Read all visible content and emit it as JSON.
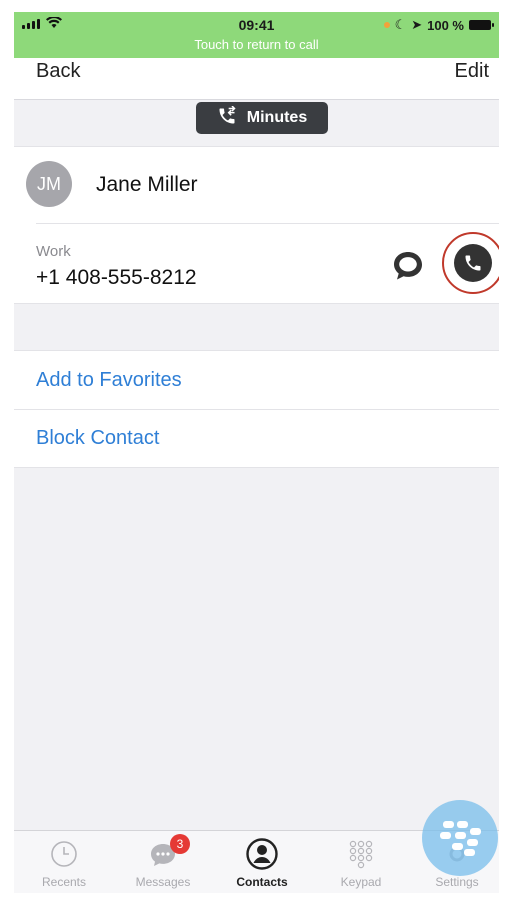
{
  "status_bar": {
    "time": "09:41",
    "banner": "Touch to return to call",
    "battery": "100 %",
    "banner_color": "#8ed97a"
  },
  "nav": {
    "back": "Back",
    "edit": "Edit"
  },
  "minutes_pill": {
    "label": "Minutes",
    "icon": "phone-transfer-icon"
  },
  "contact": {
    "initials": "JM",
    "name": "Jane Miller",
    "phone_label": "Work",
    "phone_value": "+1 408-555-8212"
  },
  "actions": {
    "add_favorites": "Add to Favorites",
    "block_contact": "Block Contact",
    "color": "#2f7fd6"
  },
  "tabs": [
    {
      "label": "Recents",
      "icon": "clock-icon"
    },
    {
      "label": "Messages",
      "icon": "chat-icon",
      "badge": "3"
    },
    {
      "label": "Contacts",
      "icon": "person-icon",
      "active": true
    },
    {
      "label": "Keypad",
      "icon": "keypad-icon"
    },
    {
      "label": "Settings",
      "icon": "gear-icon"
    }
  ],
  "colors": {
    "call_highlight": "#c0392b",
    "badge": "#e53935"
  }
}
